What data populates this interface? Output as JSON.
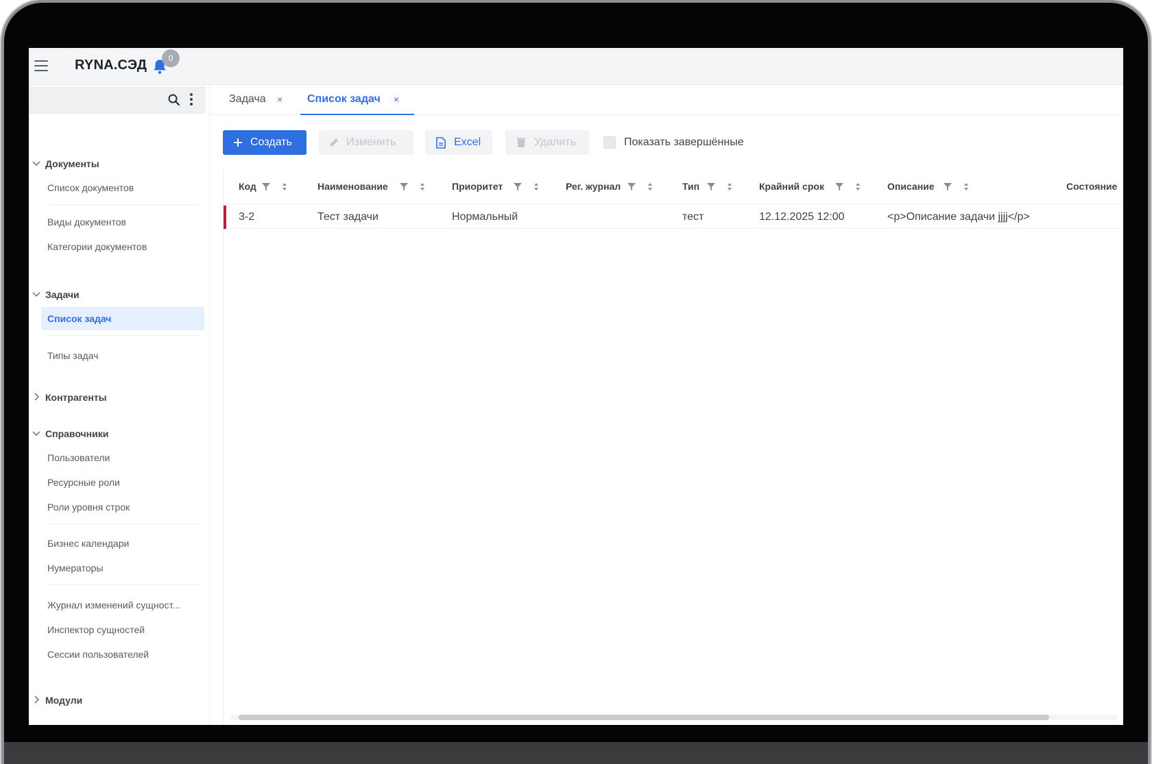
{
  "app": {
    "title": "RYNA.СЭД",
    "notifications": "0"
  },
  "sidebar": {
    "groups": [
      {
        "label": "Документы",
        "items": [
          "Список документов",
          "Виды документов",
          "Категории документов"
        ]
      },
      {
        "label": "Задачи",
        "items": [
          "Список задач",
          "Типы задач"
        ],
        "active": "Список задач"
      },
      {
        "label": "Контрагенты",
        "items": []
      },
      {
        "label": "Справочники",
        "items": [
          "Пользователи",
          "Ресурсные роли",
          "Роли уровня строк",
          "Бизнес календари",
          "Нумераторы",
          "Журнал изменений сущност...",
          "Инспектор сущностей",
          "Сессии пользователей"
        ]
      },
      {
        "label": "Модули",
        "items": []
      }
    ]
  },
  "tabs": [
    {
      "label": "Задача",
      "close": "×"
    },
    {
      "label": "Список задач",
      "close": "×",
      "active": true
    }
  ],
  "toolbar": {
    "create": "Создать",
    "edit": "Изменить",
    "excel": "Excel",
    "delete": "Удалить",
    "show_completed": "Показать завершённые"
  },
  "table": {
    "columns": [
      "Код",
      "Наименование",
      "Приоритет",
      "Рег. журнал",
      "Тип",
      "Крайний срок",
      "Описание",
      "Состояние"
    ],
    "rows": [
      [
        "3-2",
        "Тест задачи",
        "Нормальный",
        "",
        "тест",
        "12.12.2025 12:00",
        "<p>Описание задачи jjjj</p>",
        ""
      ]
    ]
  },
  "colors": {
    "accent": "#2f6fe0",
    "row_marker": "#b3203d",
    "active_item_bg": "#e6effd"
  },
  "icons": [
    "menu-icon",
    "bell-icon",
    "search-icon",
    "more-vertical-icon",
    "chevron-down-icon",
    "chevron-right-icon",
    "plus-icon",
    "pencil-icon",
    "file-icon",
    "trash-icon",
    "filter-icon",
    "sort-icon",
    "close-icon"
  ]
}
